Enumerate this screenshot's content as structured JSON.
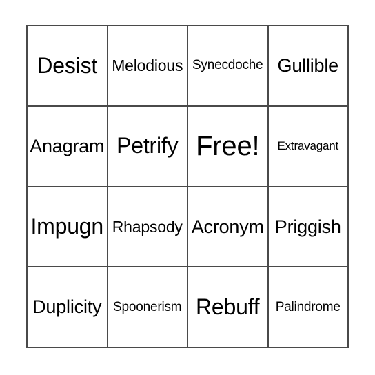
{
  "card": {
    "type": "bingo-card",
    "rows": 4,
    "columns": 4,
    "free_space_label": "Free!",
    "free_space_position": {
      "row": 2,
      "column": 3
    },
    "border_color": "#4a4a4a",
    "text_color": "#000000",
    "background_color": "#ffffff",
    "cells": [
      {
        "text": "Desist",
        "size": "sz-lg",
        "free": false
      },
      {
        "text": "Melodious",
        "size": "sz-sm",
        "free": false
      },
      {
        "text": "Synecdoche",
        "size": "sz-xs",
        "free": false
      },
      {
        "text": "Gullible",
        "size": "sz-md",
        "free": false
      },
      {
        "text": "Anagram",
        "size": "sz-md",
        "free": false
      },
      {
        "text": "Petrify",
        "size": "sz-lg",
        "free": false
      },
      {
        "text": "Free!",
        "size": "sz-xl",
        "free": true
      },
      {
        "text": "Extravagant",
        "size": "sz-xxs",
        "free": false
      },
      {
        "text": "Impugn",
        "size": "sz-lg",
        "free": false
      },
      {
        "text": "Rhapsody",
        "size": "sz-sm",
        "free": false
      },
      {
        "text": "Acronym",
        "size": "sz-md",
        "free": false
      },
      {
        "text": "Priggish",
        "size": "sz-md",
        "free": false
      },
      {
        "text": "Duplicity",
        "size": "sz-md",
        "free": false
      },
      {
        "text": "Spoonerism",
        "size": "sz-xs",
        "free": false
      },
      {
        "text": "Rebuff",
        "size": "sz-lg",
        "free": false
      },
      {
        "text": "Palindrome",
        "size": "sz-xs",
        "free": false
      }
    ]
  }
}
